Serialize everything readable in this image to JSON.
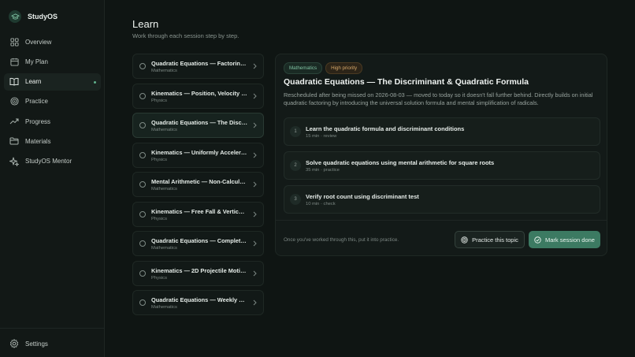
{
  "app": {
    "name": "StudyOS"
  },
  "nav": [
    {
      "label": "Overview",
      "icon": "grid-icon"
    },
    {
      "label": "My Plan",
      "icon": "calendar-icon"
    },
    {
      "label": "Learn",
      "icon": "book-icon"
    },
    {
      "label": "Practice",
      "icon": "target-icon"
    },
    {
      "label": "Progress",
      "icon": "trend-icon"
    },
    {
      "label": "Materials",
      "icon": "folder-icon"
    },
    {
      "label": "StudyOS Mentor",
      "icon": "sparkle-icon"
    }
  ],
  "settings": {
    "label": "Settings"
  },
  "page": {
    "title": "Learn",
    "subtitle": "Work through each session step by step."
  },
  "sessions": [
    {
      "title": "Quadratic Equations — Factoring ...",
      "subject": "Mathematics"
    },
    {
      "title": "Kinematics — Position, Velocity & ...",
      "subject": "Physics"
    },
    {
      "title": "Quadratic Equations — The Discri...",
      "subject": "Mathematics"
    },
    {
      "title": "Kinematics — Uniformly Accelerat...",
      "subject": "Physics"
    },
    {
      "title": "Mental Arithmetic — Non-Calcula...",
      "subject": "Mathematics"
    },
    {
      "title": "Kinematics — Free Fall & Vertical ...",
      "subject": "Physics"
    },
    {
      "title": "Quadratic Equations — Completin...",
      "subject": "Mathematics"
    },
    {
      "title": "Kinematics — 2D Projectile Motio...",
      "subject": "Physics"
    },
    {
      "title": "Quadratic Equations — Weekly Re...",
      "subject": "Mathematics"
    }
  ],
  "detail": {
    "subject_tag": "Mathematics",
    "priority_tag": "High priority",
    "title": "Quadratic Equations — The Discriminant & Quadratic Formula",
    "description": "Rescheduled after being missed on 2026-08-03 — moved to today so it doesn't fall further behind. Directly builds on initial quadratic factoring by introducing the universal solution formula and mental simplification of radicals.",
    "steps": [
      {
        "num": "1",
        "title": "Learn the quadratic formula and discriminant conditions",
        "meta": "15 min · review"
      },
      {
        "num": "2",
        "title": "Solve quadratic equations using mental arithmetic for square roots",
        "meta": "35 min · practice"
      },
      {
        "num": "3",
        "title": "Verify root count using discriminant test",
        "meta": "10 min · check"
      }
    ],
    "hint": "Once you've worked through this, put it into practice.",
    "practice_label": "Practice this topic",
    "done_label": "Mark session done"
  },
  "colors": {
    "accent": "#3c7a62",
    "background": "#0f1513",
    "priority": "#d7a96a"
  }
}
